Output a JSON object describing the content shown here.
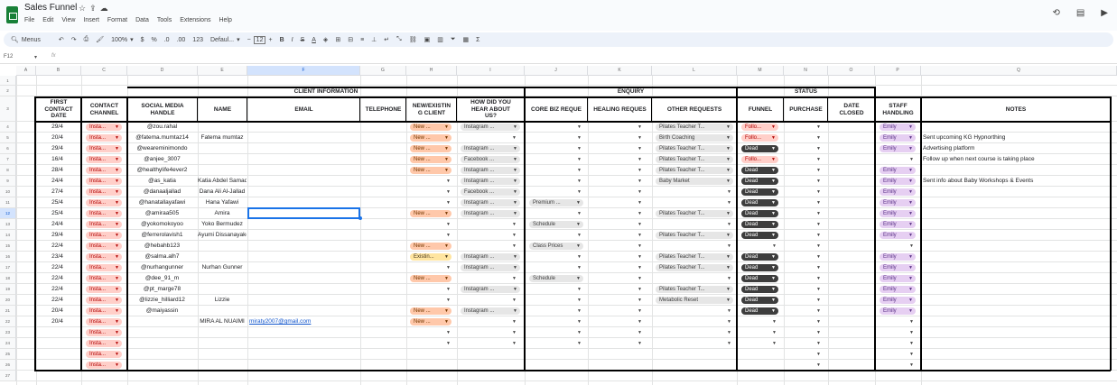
{
  "app": {
    "title": "Sales Funnel",
    "menus": [
      "File",
      "Edit",
      "View",
      "Insert",
      "Format",
      "Data",
      "Tools",
      "Extensions",
      "Help"
    ]
  },
  "toolbar": {
    "search": "Menus",
    "zoom": "100%",
    "currency": "$",
    "percent": "%",
    "dec_less": ".0",
    "dec_more": ".00",
    "format123": "123",
    "font": "Defaul...",
    "font_size": "12"
  },
  "formula": {
    "cell_ref": "F12",
    "fx": "fx"
  },
  "columns": [
    "A",
    "B",
    "C",
    "D",
    "E",
    "F",
    "G",
    "H",
    "I",
    "J",
    "K",
    "L",
    "M",
    "N",
    "O",
    "P",
    "Q"
  ],
  "rows": [
    "1",
    "2",
    "3",
    "4",
    "5",
    "6",
    "7",
    "8",
    "9",
    "10",
    "11",
    "12",
    "13",
    "14",
    "15",
    "16",
    "17",
    "18",
    "19",
    "20",
    "21",
    "22",
    "23",
    "24",
    "25",
    "26",
    "27"
  ],
  "sections": {
    "client": "CLIENT INFORMATION",
    "enquiry": "ENQUIRY",
    "status": "STATUS"
  },
  "headers": {
    "first_contact": "FIRST\nCONTACT\nDATE",
    "contact_channel": "CONTACT\nCHANNEL",
    "social": "SOCIAL MEDIA\nHANDLE",
    "name": "NAME",
    "email": "EMAIL",
    "telephone": "TELEPHONE",
    "new_existing": "NEW/EXISTIN\nG CLIENT",
    "how_hear": "HOW DID YOU\nHEAR ABOUT\nUS?",
    "core_biz": "CORE BIZ REQUE",
    "healing": "HEALING REQUES",
    "other": "OTHER REQUESTS",
    "funnel": "FUNNEL",
    "purchase": "PURCHASE",
    "date_closed": "DATE\nCLOSED",
    "staff": "STAFF\nHANDLING",
    "notes": "NOTES"
  },
  "data_rows": [
    {
      "date": "29/4",
      "channel": "Insta...",
      "handle": "@zou.rahal",
      "name": "",
      "email": "",
      "newex": "New ...",
      "how": "Instagram ...",
      "core": "",
      "healing": "",
      "other": "Pilates Teacher T...",
      "funnel": "Follo...",
      "purchase": "",
      "staff": "Emily",
      "notes": ""
    },
    {
      "date": "20/4",
      "channel": "Insta...",
      "handle": "@fatema.mumtaz14",
      "name": "Fatema mumtaz",
      "email": "",
      "newex": "New ...",
      "how": "",
      "core": "",
      "healing": "",
      "other": "Birth Coaching",
      "funnel": "Follo...",
      "purchase": "",
      "staff": "Emily",
      "notes": "Sent upcoming KG Hypnorthing"
    },
    {
      "date": "29/4",
      "channel": "Insta...",
      "handle": "@weareminimondo",
      "name": "",
      "email": "",
      "newex": "New ...",
      "how": "Instagram ...",
      "core": "",
      "healing": "",
      "other": "Pilates Teacher T...",
      "funnel": "Dead",
      "purchase": "",
      "staff": "Emily",
      "notes": "Advertising platform"
    },
    {
      "date": "16/4",
      "channel": "Insta...",
      "handle": "@anjee_3007",
      "name": "",
      "email": "",
      "newex": "New ...",
      "how": "Facebook ...",
      "core": "",
      "healing": "",
      "other": "Pilates Teacher T...",
      "funnel": "Follo...",
      "purchase": "",
      "staff": "",
      "notes": "Follow up when next course is taking place"
    },
    {
      "date": "28/4",
      "channel": "Insta...",
      "handle": "@healthylife4ever2",
      "name": "",
      "email": "",
      "newex": "New ...",
      "how": "Instagram ...",
      "core": "",
      "healing": "",
      "other": "Pilates Teacher T...",
      "funnel": "Dead",
      "purchase": "",
      "staff": "Emily",
      "notes": ""
    },
    {
      "date": "24/4",
      "channel": "Insta...",
      "handle": "@as_katia",
      "name": "Katia Abdel Samad",
      "email": "",
      "newex": "",
      "how": "Instagram ...",
      "core": "",
      "healing": "",
      "other": "Baby Market",
      "funnel": "Dead",
      "purchase": "",
      "staff": "Emily",
      "notes": "Sent info about Baby Workshops & Events"
    },
    {
      "date": "27/4",
      "channel": "Insta...",
      "handle": "@danaaljallad",
      "name": "Dana Ali Al-Jallad",
      "email": "",
      "newex": "",
      "how": "Facebook ...",
      "core": "",
      "healing": "",
      "other": "",
      "funnel": "Dead",
      "purchase": "",
      "staff": "Emily",
      "notes": ""
    },
    {
      "date": "25/4",
      "channel": "Insta...",
      "handle": "@hanatallayafawi",
      "name": "Hana Yafawi",
      "email": "",
      "newex": "",
      "how": "Instagram ...",
      "core": "Premium ...",
      "healing": "",
      "other": "",
      "funnel": "Dead",
      "purchase": "",
      "staff": "Emily",
      "notes": ""
    },
    {
      "date": "25/4",
      "channel": "Insta...",
      "handle": "@amiraa505",
      "name": "Amira",
      "email": "",
      "newex": "New ...",
      "how": "Instagram ...",
      "core": "",
      "healing": "",
      "other": "Pilates Teacher T...",
      "funnel": "Dead",
      "purchase": "",
      "staff": "Emily",
      "notes": ""
    },
    {
      "date": "24/4",
      "channel": "Insta...",
      "handle": "@yokomokoyoo",
      "name": "Yoko Bermudez",
      "email": "",
      "newex": "",
      "how": "",
      "core": "Schedule",
      "healing": "",
      "other": "",
      "funnel": "Dead",
      "purchase": "",
      "staff": "Emily",
      "notes": ""
    },
    {
      "date": "29/4",
      "channel": "Insta...",
      "handle": "@ferrerolavish1",
      "name": "Ayumi Dissanayake",
      "email": "",
      "newex": "",
      "how": "",
      "core": "",
      "healing": "",
      "other": "Pilates Teacher T...",
      "funnel": "Dead",
      "purchase": "",
      "staff": "Emily",
      "notes": ""
    },
    {
      "date": "22/4",
      "channel": "Insta...",
      "handle": "@hebahb123",
      "name": "",
      "email": "",
      "newex": "New ...",
      "how": "",
      "core": "Class Prices",
      "healing": "",
      "other": "",
      "funnel": "",
      "purchase": "",
      "staff": "",
      "notes": ""
    },
    {
      "date": "23/4",
      "channel": "Insta...",
      "handle": "@salma.alh7",
      "name": "",
      "email": "",
      "newex": "Existin...",
      "how": "Instagram ...",
      "core": "",
      "healing": "",
      "other": "Pilates Teacher T...",
      "funnel": "Dead",
      "purchase": "",
      "staff": "Emily",
      "notes": ""
    },
    {
      "date": "22/4",
      "channel": "Insta...",
      "handle": "@nurhangunner",
      "name": "Nurhan Gunner",
      "email": "",
      "newex": "",
      "how": "Instagram ...",
      "core": "",
      "healing": "",
      "other": "Pilates Teacher T...",
      "funnel": "Dead",
      "purchase": "",
      "staff": "Emily",
      "notes": ""
    },
    {
      "date": "22/4",
      "channel": "Insta...",
      "handle": "@dee_91_m",
      "name": "",
      "email": "",
      "newex": "New ...",
      "how": "",
      "core": "Schedule",
      "healing": "",
      "other": "",
      "funnel": "Dead",
      "purchase": "",
      "staff": "Emily",
      "notes": ""
    },
    {
      "date": "22/4",
      "channel": "Insta...",
      "handle": "@pt_marge78",
      "name": "",
      "email": "",
      "newex": "",
      "how": "Instagram ...",
      "core": "",
      "healing": "",
      "other": "Pilates Teacher T...",
      "funnel": "Dead",
      "purchase": "",
      "staff": "Emily",
      "notes": ""
    },
    {
      "date": "22/4",
      "channel": "Insta...",
      "handle": "@lizzie_hilliard12",
      "name": "Lizzie",
      "email": "",
      "newex": "",
      "how": "",
      "core": "",
      "healing": "",
      "other": "Metabolic Reset",
      "funnel": "Dead",
      "purchase": "",
      "staff": "Emily",
      "notes": ""
    },
    {
      "date": "20/4",
      "channel": "Insta...",
      "handle": "@maiyassin",
      "name": "",
      "email": "",
      "newex": "New ...",
      "how": "Instagram ...",
      "core": "",
      "healing": "",
      "other": "",
      "funnel": "Dead",
      "purchase": "",
      "staff": "Emily",
      "notes": ""
    },
    {
      "date": "20/4",
      "channel": "Insta...",
      "handle": "",
      "name": "MIRA AL NUAIMI",
      "email": "miraty2007@gmail.com",
      "newex": "New ...",
      "how": "",
      "core": "",
      "healing": "",
      "other": "",
      "funnel": "",
      "purchase": "",
      "staff": "",
      "notes": ""
    },
    {
      "date": "",
      "channel": "Insta...",
      "handle": "",
      "name": "",
      "email": "",
      "newex": "",
      "how": "",
      "core": "",
      "healing": "",
      "other": "",
      "funnel": "",
      "purchase": "",
      "staff": "",
      "notes": ""
    },
    {
      "date": "",
      "channel": "Insta...",
      "handle": "",
      "name": "",
      "email": "",
      "newex": "",
      "how": "",
      "core": "",
      "healing": "",
      "other": "",
      "funnel": "",
      "purchase": "",
      "staff": "",
      "notes": ""
    },
    {
      "date": "",
      "channel": "Insta...",
      "handle": "",
      "name": "",
      "email": "",
      "newex": "",
      "how": "",
      "core": "",
      "healing": "",
      "other": "",
      "funnel": "",
      "purchase": "",
      "staff": "",
      "notes": ""
    },
    {
      "date": "",
      "channel": "Insta...",
      "handle": "",
      "name": "",
      "email": "",
      "newex": "",
      "how": "",
      "core": "",
      "healing": "",
      "other": "",
      "funnel": "",
      "purchase": "",
      "staff": "",
      "notes": ""
    }
  ],
  "colors": {
    "funnel_follow": "#ffcfc9",
    "funnel_dead": "#3d3d3d",
    "staff": "#e6cff2",
    "new": "#ffc8aa",
    "existing": "#ffe5a0",
    "selection": "#1a73e8"
  }
}
